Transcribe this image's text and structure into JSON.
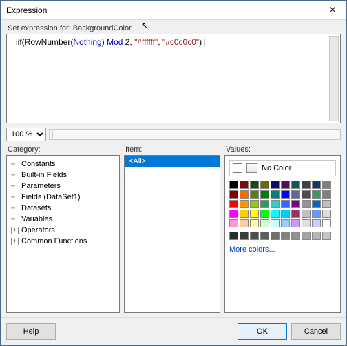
{
  "window": {
    "title": "Expression"
  },
  "header": {
    "set_expr_label": "Set expression for: BackgroundColor"
  },
  "expression": {
    "prefix": "=iif(RowNumber(",
    "arg1": "Nothing",
    "mid1": ") ",
    "kw_mod": "Mod",
    "mid2": " 2, ",
    "str1": "\"#ffffff\"",
    "mid3": ", ",
    "str2": "\"#c0c0c0\"",
    "suffix": ")"
  },
  "zoom": {
    "value": "100 %"
  },
  "panes": {
    "category_label": "Category:",
    "item_label": "Item:",
    "values_label": "Values:"
  },
  "categories": [
    {
      "label": "Constants",
      "expand": "dots"
    },
    {
      "label": "Built-in Fields",
      "expand": "dots"
    },
    {
      "label": "Parameters",
      "expand": "dots"
    },
    {
      "label": "Fields (DataSet1)",
      "expand": "dots"
    },
    {
      "label": "Datasets",
      "expand": "dots"
    },
    {
      "label": "Variables",
      "expand": "dots"
    },
    {
      "label": "Operators",
      "expand": "plus"
    },
    {
      "label": "Common Functions",
      "expand": "plus"
    }
  ],
  "items": {
    "all": "<All>"
  },
  "values": {
    "no_color_label": "No Color",
    "more_colors": "More colors...",
    "colors_row1": [
      "#000000",
      "#7c0b0b",
      "#0c4f0c",
      "#6a6a0a",
      "#0b0b7a",
      "#5a0a5a",
      "#0a5a5a",
      "#404040",
      "#0a3a6a",
      "#808080"
    ],
    "colors_row2": [
      "#800000",
      "#ff6a00",
      "#5e7a12",
      "#008000",
      "#008080",
      "#0000ff",
      "#666699",
      "#4d4d4d",
      "#339966",
      "#808080"
    ],
    "colors_row3": [
      "#ff0000",
      "#ff9900",
      "#99cc00",
      "#339966",
      "#33cccc",
      "#3366ff",
      "#800080",
      "#969696",
      "#0066cc",
      "#c0c0c0"
    ],
    "colors_row4": [
      "#ff00ff",
      "#ffcc00",
      "#ffff00",
      "#00ff00",
      "#00ffff",
      "#00ccff",
      "#993366",
      "#c0c0c0",
      "#6699ff",
      "#dcdcdc"
    ],
    "colors_row5": [
      "#ff99cc",
      "#ffcc99",
      "#ffff99",
      "#ccffcc",
      "#ccffff",
      "#99ccff",
      "#cc99ff",
      "#e0e0e0",
      "#ccccff",
      "#ffffff"
    ],
    "grays": [
      "#2b2b2b",
      "#3c3c3c",
      "#4d4d4d",
      "#5e5e5e",
      "#707070",
      "#818181",
      "#929292",
      "#a3a3a3",
      "#b5b5b5",
      "#c6c6c6"
    ]
  },
  "footer": {
    "help": "Help",
    "ok": "OK",
    "cancel": "Cancel"
  }
}
